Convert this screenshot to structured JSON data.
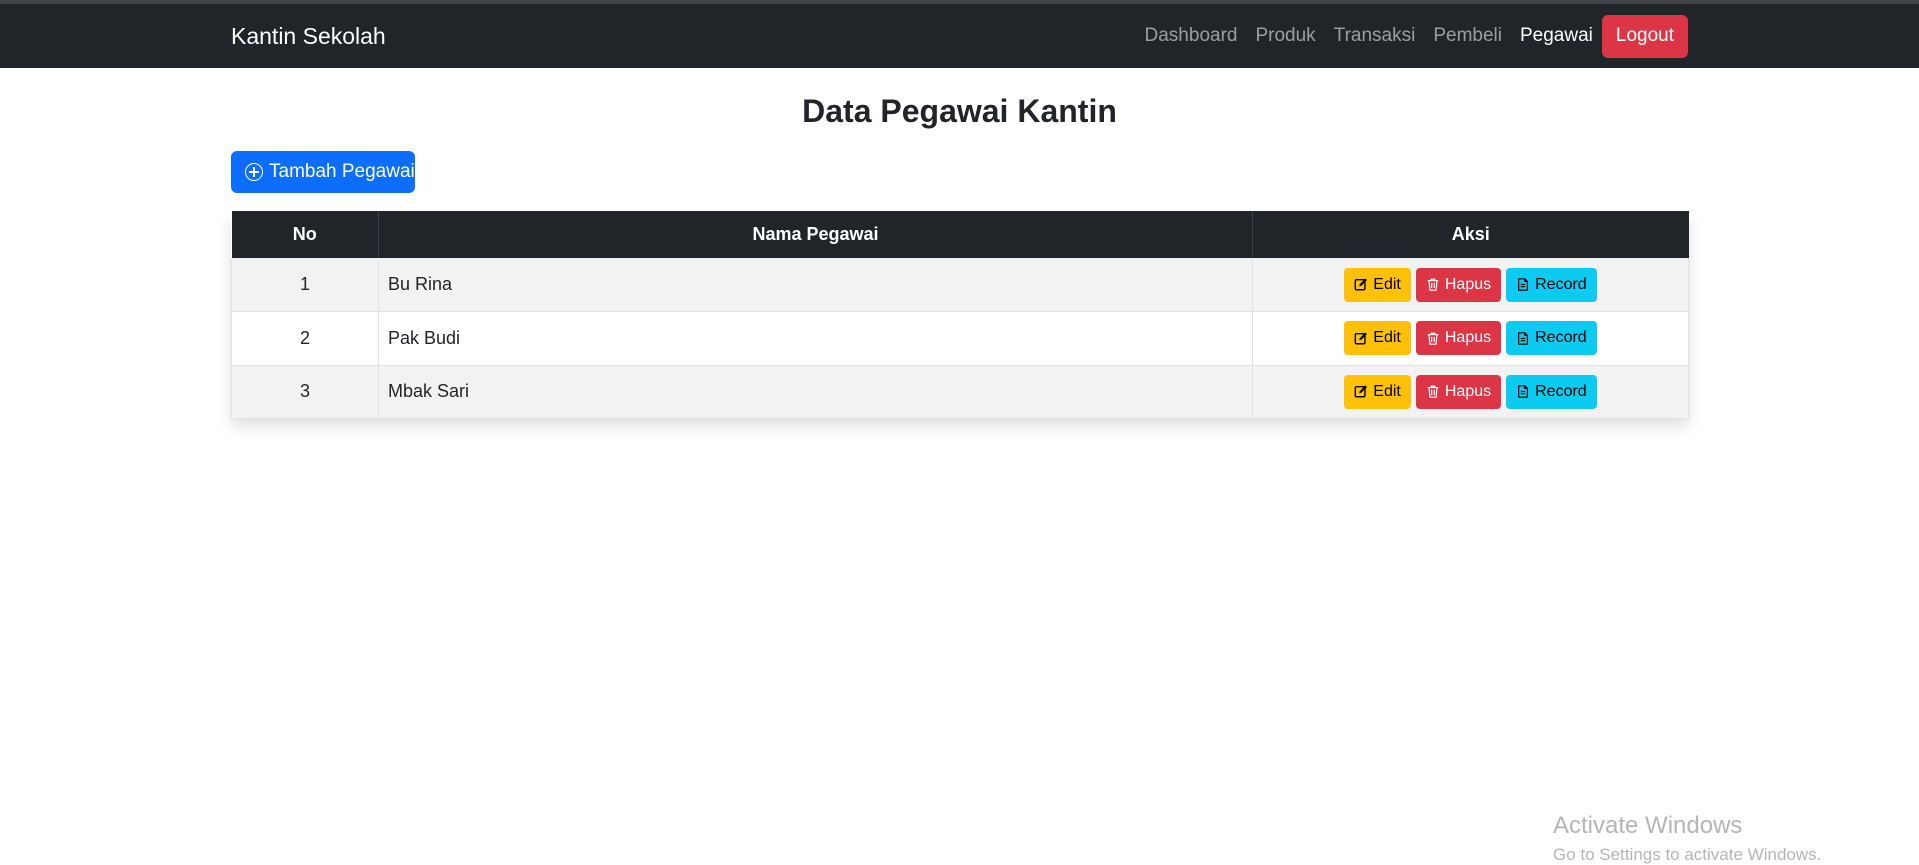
{
  "navbar": {
    "brand": "Kantin Sekolah",
    "links": [
      {
        "label": "Dashboard",
        "active": false
      },
      {
        "label": "Produk",
        "active": false
      },
      {
        "label": "Transaksi",
        "active": false
      },
      {
        "label": "Pembeli",
        "active": false
      },
      {
        "label": "Pegawai",
        "active": true
      }
    ],
    "logout_label": "Logout"
  },
  "page": {
    "title": "Data Pegawai Kantin",
    "add_button_label": "Tambah Pegawai"
  },
  "table": {
    "headers": {
      "no": "No",
      "name": "Nama Pegawai",
      "actions": "Aksi"
    },
    "rows": [
      {
        "no": "1",
        "name": "Bu Rina"
      },
      {
        "no": "2",
        "name": "Pak Budi"
      },
      {
        "no": "3",
        "name": "Mbak Sari"
      }
    ],
    "action_labels": {
      "edit": "Edit",
      "hapus": "Hapus",
      "record": "Record"
    }
  },
  "colors": {
    "navbar_bg": "#212529",
    "primary": "#0d6efd",
    "warning": "#ffc107",
    "danger": "#dc3545",
    "info": "#0dcaf0"
  },
  "watermark": {
    "title": "Activate Windows",
    "subtitle": "Go to Settings to activate Windows."
  }
}
